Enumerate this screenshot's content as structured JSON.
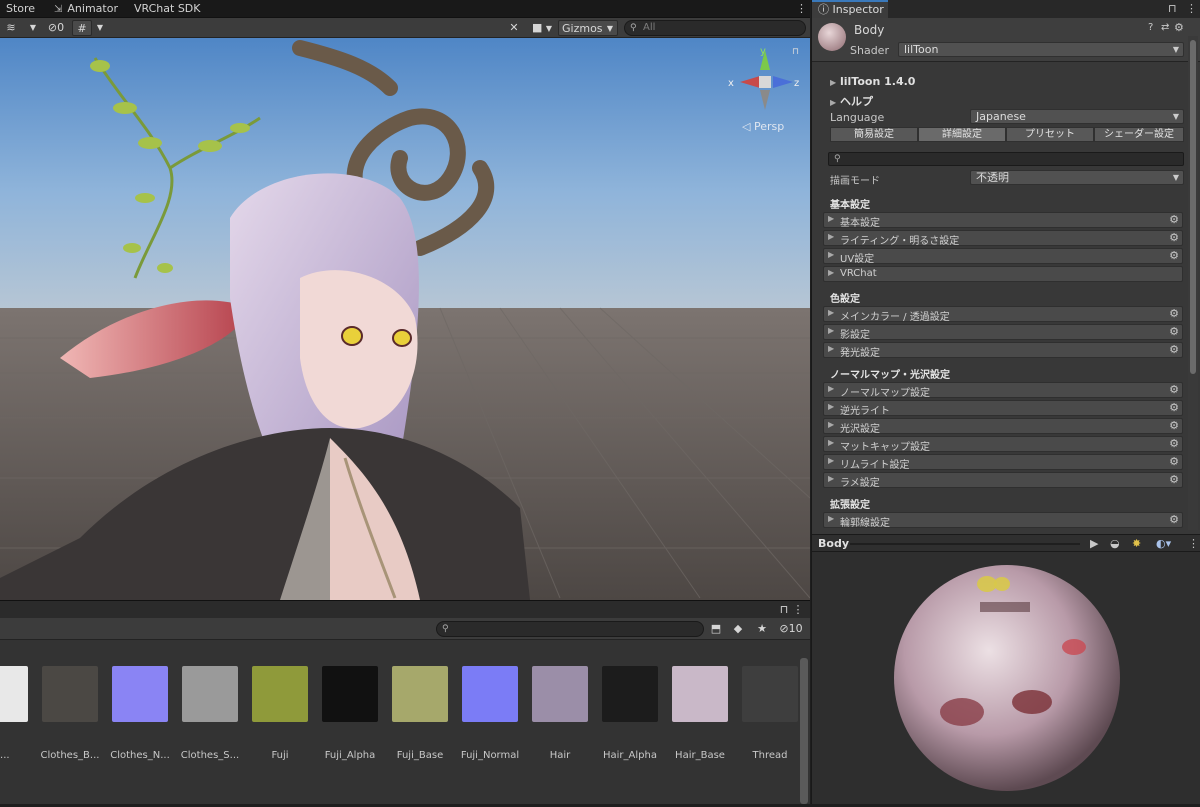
{
  "tabs": {
    "store": "Store",
    "animator": "Animator",
    "vrchat_sdk": "VRChat SDK"
  },
  "scene_toolbar": {
    "hidden_count": "0",
    "gizmos_label": "Gizmos",
    "search_placeholder": "All",
    "persp_label": "Persp",
    "axis_x": "x",
    "axis_y": "y",
    "axis_z": "z"
  },
  "project": {
    "hidden_count": "10",
    "assets": [
      {
        "name": "Al...",
        "swatch": "#e8e8e8"
      },
      {
        "name": "Clothes_B...",
        "swatch": "#4b4844"
      },
      {
        "name": "Clothes_N...",
        "swatch": "#8a84f4"
      },
      {
        "name": "Clothes_S...",
        "swatch": "#9a9a9a"
      },
      {
        "name": "Fuji",
        "swatch": "#8f9a3a"
      },
      {
        "name": "Fuji_Alpha",
        "swatch": "#111111"
      },
      {
        "name": "Fuji_Base",
        "swatch": "#a6a86b"
      },
      {
        "name": "Fuji_Normal",
        "swatch": "#7b7cf6"
      },
      {
        "name": "Hair",
        "swatch": "#9b8ea8"
      },
      {
        "name": "Hair_Alpha",
        "swatch": "#1c1c1c"
      },
      {
        "name": "Hair_Base",
        "swatch": "#c9b8c8"
      },
      {
        "name": "Thread",
        "swatch": "#3e3e3e"
      }
    ]
  },
  "inspector": {
    "tab_label": "Inspector",
    "object_name": "Body",
    "shader_label": "Shader",
    "shader_value": "lilToon",
    "version": "lilToon 1.4.0",
    "help": "ヘルプ",
    "language_label": "Language",
    "language_value": "Japanese",
    "modes": [
      "簡易設定",
      "詳細設定",
      "プリセット",
      "シェーダー設定"
    ],
    "active_mode": 1,
    "render_mode_label": "描画モード",
    "render_mode_value": "不透明",
    "sections": [
      {
        "title": "基本設定",
        "items": [
          {
            "label": "基本設定",
            "gear": true
          },
          {
            "label": "ライティング・明るさ設定",
            "gear": true
          },
          {
            "label": "UV設定",
            "gear": true
          },
          {
            "label": "VRChat",
            "gear": false
          }
        ]
      },
      {
        "title": "色設定",
        "items": [
          {
            "label": "メインカラー / 透過設定",
            "gear": true
          },
          {
            "label": "影設定",
            "gear": true
          },
          {
            "label": "発光設定",
            "gear": true
          }
        ]
      },
      {
        "title": "ノーマルマップ・光沢設定",
        "items": [
          {
            "label": "ノーマルマップ設定",
            "gear": true
          },
          {
            "label": "逆光ライト",
            "gear": true
          },
          {
            "label": "光沢設定",
            "gear": true
          },
          {
            "label": "マットキャップ設定",
            "gear": true
          },
          {
            "label": "リムライト設定",
            "gear": true
          },
          {
            "label": "ラメ設定",
            "gear": true
          }
        ]
      },
      {
        "title": "拡張設定",
        "items": [
          {
            "label": "輪郭線設定",
            "gear": true
          }
        ]
      }
    ],
    "preview_title": "Body"
  },
  "colors": {
    "accent": "#3a79bb",
    "panel": "#383838",
    "sky_top": "#4f86c6",
    "ground": "#5c5652"
  }
}
